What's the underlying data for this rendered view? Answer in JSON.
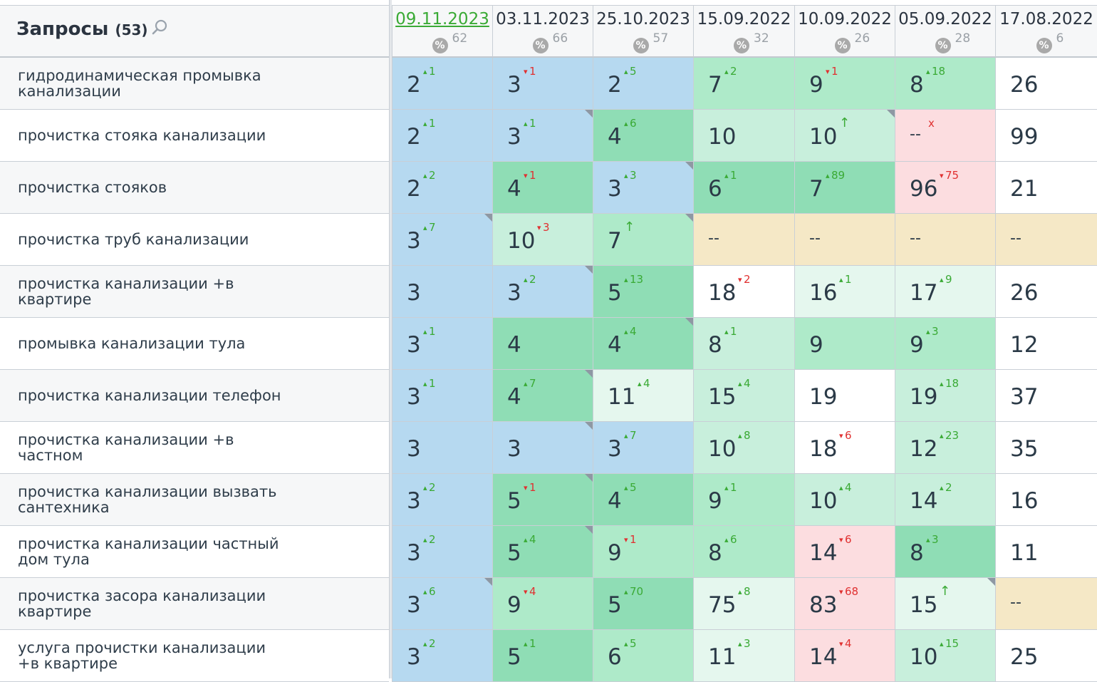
{
  "header": {
    "title": "Запросы",
    "count": "(53)"
  },
  "colors": {
    "active_date": "#3aaa35",
    "delta_up": "#3aaa35",
    "delta_down": "#e03030"
  },
  "dates": [
    {
      "date": "09.11.2023",
      "pct": "62",
      "active": true
    },
    {
      "date": "03.11.2023",
      "pct": "66",
      "active": false
    },
    {
      "date": "25.10.2023",
      "pct": "57",
      "active": false
    },
    {
      "date": "15.09.2022",
      "pct": "32",
      "active": false
    },
    {
      "date": "10.09.2022",
      "pct": "26",
      "active": false
    },
    {
      "date": "05.09.2022",
      "pct": "28",
      "active": false
    },
    {
      "date": "17.08.2022",
      "pct": "6",
      "active": false
    }
  ],
  "pct_icon": "%",
  "rows": [
    {
      "query": "гидродинамическая промывка канализации",
      "cells": [
        {
          "v": "2",
          "d": "1",
          "dir": "up",
          "c": "blue"
        },
        {
          "v": "3",
          "d": "1",
          "dir": "down",
          "c": "blue"
        },
        {
          "v": "2",
          "d": "5",
          "dir": "up",
          "c": "blue"
        },
        {
          "v": "7",
          "d": "2",
          "dir": "up",
          "c": "g2"
        },
        {
          "v": "9",
          "d": "1",
          "dir": "down",
          "c": "g2"
        },
        {
          "v": "8",
          "d": "18",
          "dir": "up",
          "c": "g2"
        },
        {
          "v": "26",
          "c": "white"
        }
      ]
    },
    {
      "query": "прочистка стояка канализации",
      "cells": [
        {
          "v": "2",
          "d": "1",
          "dir": "up",
          "c": "blue"
        },
        {
          "v": "3",
          "d": "1",
          "dir": "up",
          "c": "blue",
          "corner": true
        },
        {
          "v": "4",
          "d": "6",
          "dir": "up",
          "c": "g1"
        },
        {
          "v": "10",
          "c": "g3"
        },
        {
          "v": "10",
          "d": "↑",
          "dir": "arrow",
          "c": "g3",
          "corner": true
        },
        {
          "v": "--",
          "d": "x",
          "dir": "x",
          "c": "pink"
        },
        {
          "v": "99",
          "c": "white"
        }
      ]
    },
    {
      "query": "прочистка стояков",
      "cells": [
        {
          "v": "2",
          "d": "2",
          "dir": "up",
          "c": "blue"
        },
        {
          "v": "4",
          "d": "1",
          "dir": "down",
          "c": "g1"
        },
        {
          "v": "3",
          "d": "3",
          "dir": "up",
          "c": "blue",
          "corner": true
        },
        {
          "v": "6",
          "d": "1",
          "dir": "up",
          "c": "g1"
        },
        {
          "v": "7",
          "d": "89",
          "dir": "up",
          "c": "g1"
        },
        {
          "v": "96",
          "d": "75",
          "dir": "down",
          "c": "pink"
        },
        {
          "v": "21",
          "c": "white"
        }
      ]
    },
    {
      "query": "прочистка труб канализации",
      "cells": [
        {
          "v": "3",
          "d": "7",
          "dir": "up",
          "c": "blue",
          "corner": true
        },
        {
          "v": "10",
          "d": "3",
          "dir": "down",
          "c": "g3"
        },
        {
          "v": "7",
          "d": "↑",
          "dir": "arrow",
          "c": "g2",
          "corner": true
        },
        {
          "v": "--",
          "c": "sand"
        },
        {
          "v": "--",
          "c": "sand"
        },
        {
          "v": "--",
          "c": "sand"
        },
        {
          "v": "--",
          "c": "sand"
        }
      ]
    },
    {
      "query": "прочистка канализации +в квартире",
      "cells": [
        {
          "v": "3",
          "c": "blue"
        },
        {
          "v": "3",
          "d": "2",
          "dir": "up",
          "c": "blue",
          "corner": true
        },
        {
          "v": "5",
          "d": "13",
          "dir": "up",
          "c": "g1"
        },
        {
          "v": "18",
          "d": "2",
          "dir": "down",
          "c": "white"
        },
        {
          "v": "16",
          "d": "1",
          "dir": "up",
          "c": "g4"
        },
        {
          "v": "17",
          "d": "9",
          "dir": "up",
          "c": "g4"
        },
        {
          "v": "26",
          "c": "white"
        }
      ]
    },
    {
      "query": "промывка канализации тула",
      "cells": [
        {
          "v": "3",
          "d": "1",
          "dir": "up",
          "c": "blue"
        },
        {
          "v": "4",
          "c": "g1"
        },
        {
          "v": "4",
          "d": "4",
          "dir": "up",
          "c": "g1",
          "corner": true
        },
        {
          "v": "8",
          "d": "1",
          "dir": "up",
          "c": "g3"
        },
        {
          "v": "9",
          "c": "g2"
        },
        {
          "v": "9",
          "d": "3",
          "dir": "up",
          "c": "g2"
        },
        {
          "v": "12",
          "c": "white"
        }
      ]
    },
    {
      "query": "прочистка канализации телефон",
      "cells": [
        {
          "v": "3",
          "d": "1",
          "dir": "up",
          "c": "blue"
        },
        {
          "v": "4",
          "d": "7",
          "dir": "up",
          "c": "g1",
          "corner": true
        },
        {
          "v": "11",
          "d": "4",
          "dir": "up",
          "c": "g4"
        },
        {
          "v": "15",
          "d": "4",
          "dir": "up",
          "c": "g3"
        },
        {
          "v": "19",
          "c": "white"
        },
        {
          "v": "19",
          "d": "18",
          "dir": "up",
          "c": "g3"
        },
        {
          "v": "37",
          "c": "white"
        }
      ]
    },
    {
      "query": "прочистка канализации +в частном",
      "cells": [
        {
          "v": "3",
          "c": "blue"
        },
        {
          "v": "3",
          "c": "blue",
          "corner": true
        },
        {
          "v": "3",
          "d": "7",
          "dir": "up",
          "c": "blue"
        },
        {
          "v": "10",
          "d": "8",
          "dir": "up",
          "c": "g3"
        },
        {
          "v": "18",
          "d": "6",
          "dir": "down",
          "c": "white"
        },
        {
          "v": "12",
          "d": "23",
          "dir": "up",
          "c": "g3"
        },
        {
          "v": "35",
          "c": "white"
        }
      ]
    },
    {
      "query": "прочистка канализации вызвать сантехника",
      "cells": [
        {
          "v": "3",
          "d": "2",
          "dir": "up",
          "c": "blue"
        },
        {
          "v": "5",
          "d": "1",
          "dir": "down",
          "c": "g1",
          "corner": true
        },
        {
          "v": "4",
          "d": "5",
          "dir": "up",
          "c": "g1"
        },
        {
          "v": "9",
          "d": "1",
          "dir": "up",
          "c": "g2"
        },
        {
          "v": "10",
          "d": "4",
          "dir": "up",
          "c": "g3"
        },
        {
          "v": "14",
          "d": "2",
          "dir": "up",
          "c": "g3"
        },
        {
          "v": "16",
          "c": "white"
        }
      ]
    },
    {
      "query": "прочистка канализации частный дом тула",
      "cells": [
        {
          "v": "3",
          "d": "2",
          "dir": "up",
          "c": "blue"
        },
        {
          "v": "5",
          "d": "4",
          "dir": "up",
          "c": "g1",
          "corner": true
        },
        {
          "v": "9",
          "d": "1",
          "dir": "down",
          "c": "g2"
        },
        {
          "v": "8",
          "d": "6",
          "dir": "up",
          "c": "g2"
        },
        {
          "v": "14",
          "d": "6",
          "dir": "down",
          "c": "pink"
        },
        {
          "v": "8",
          "d": "3",
          "dir": "up",
          "c": "g1"
        },
        {
          "v": "11",
          "c": "white"
        }
      ]
    },
    {
      "query": "прочистка засора канализации квартире",
      "cells": [
        {
          "v": "3",
          "d": "6",
          "dir": "up",
          "c": "blue",
          "corner": true
        },
        {
          "v": "9",
          "d": "4",
          "dir": "down",
          "c": "g2"
        },
        {
          "v": "5",
          "d": "70",
          "dir": "up",
          "c": "g1"
        },
        {
          "v": "75",
          "d": "8",
          "dir": "up",
          "c": "g4"
        },
        {
          "v": "83",
          "d": "68",
          "dir": "down",
          "c": "pink"
        },
        {
          "v": "15",
          "d": "↑",
          "dir": "arrow",
          "c": "g4",
          "corner": true
        },
        {
          "v": "--",
          "c": "sand"
        }
      ]
    },
    {
      "query": "услуга прочистки канализации +в квартире",
      "cells": [
        {
          "v": "3",
          "d": "2",
          "dir": "up",
          "c": "blue"
        },
        {
          "v": "5",
          "d": "1",
          "dir": "up",
          "c": "g1"
        },
        {
          "v": "6",
          "d": "5",
          "dir": "up",
          "c": "g2"
        },
        {
          "v": "11",
          "d": "3",
          "dir": "up",
          "c": "g4"
        },
        {
          "v": "14",
          "d": "4",
          "dir": "down",
          "c": "pink"
        },
        {
          "v": "10",
          "d": "15",
          "dir": "up",
          "c": "g3"
        },
        {
          "v": "25",
          "c": "white"
        }
      ]
    }
  ]
}
